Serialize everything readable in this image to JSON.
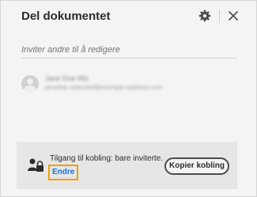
{
  "dialog": {
    "title": "Del dokumentet",
    "icons": {
      "settings": "gear-icon",
      "close": "close-icon"
    }
  },
  "invite": {
    "placeholder": "Inviter andre til å redigere"
  },
  "person": {
    "name": "Jane Doe Miz",
    "email": "janedoe.redacted@example-address.com"
  },
  "access": {
    "text": "Tilgang til kobling: bare inviterte.",
    "change_label": "Endre",
    "copy_label": "Kopier kobling",
    "icon": "lock-person-icon"
  }
}
